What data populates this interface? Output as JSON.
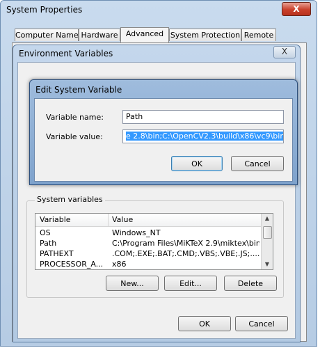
{
  "system_properties": {
    "title": "System Properties",
    "close_label": "X",
    "tabs": [
      {
        "label": "Computer Name"
      },
      {
        "label": "Hardware"
      },
      {
        "label": "Advanced"
      },
      {
        "label": "System Protection"
      },
      {
        "label": "Remote"
      }
    ],
    "active_tab": "Advanced",
    "ok_label": "OK",
    "cancel_label": "Cancel"
  },
  "environment_variables": {
    "title": "Environment Variables",
    "close_label": "X",
    "system_variables": {
      "group_label": "System variables",
      "columns": [
        "Variable",
        "Value"
      ],
      "rows": [
        {
          "variable": "OS",
          "value": "Windows_NT"
        },
        {
          "variable": "Path",
          "value": "C:\\Program Files\\MiKTeX 2.9\\miktex\\bin..."
        },
        {
          "variable": "PATHEXT",
          "value": ".COM;.EXE;.BAT;.CMD;.VBS;.VBE;.JS;...."
        },
        {
          "variable": "PROCESSOR_A...",
          "value": "x86"
        }
      ],
      "new_label": "New...",
      "edit_label": "Edit...",
      "delete_label": "Delete"
    },
    "ok_label": "OK",
    "cancel_label": "Cancel"
  },
  "edit_system_variable": {
    "title": "Edit System Variable",
    "name_label": "Variable name:",
    "name_value": "Path",
    "value_label": "Variable value:",
    "value_value": "e 2.8\\bin;C:\\OpenCV2.3\\build\\x86\\vc9\\bin",
    "ok_label": "OK",
    "cancel_label": "Cancel"
  }
}
